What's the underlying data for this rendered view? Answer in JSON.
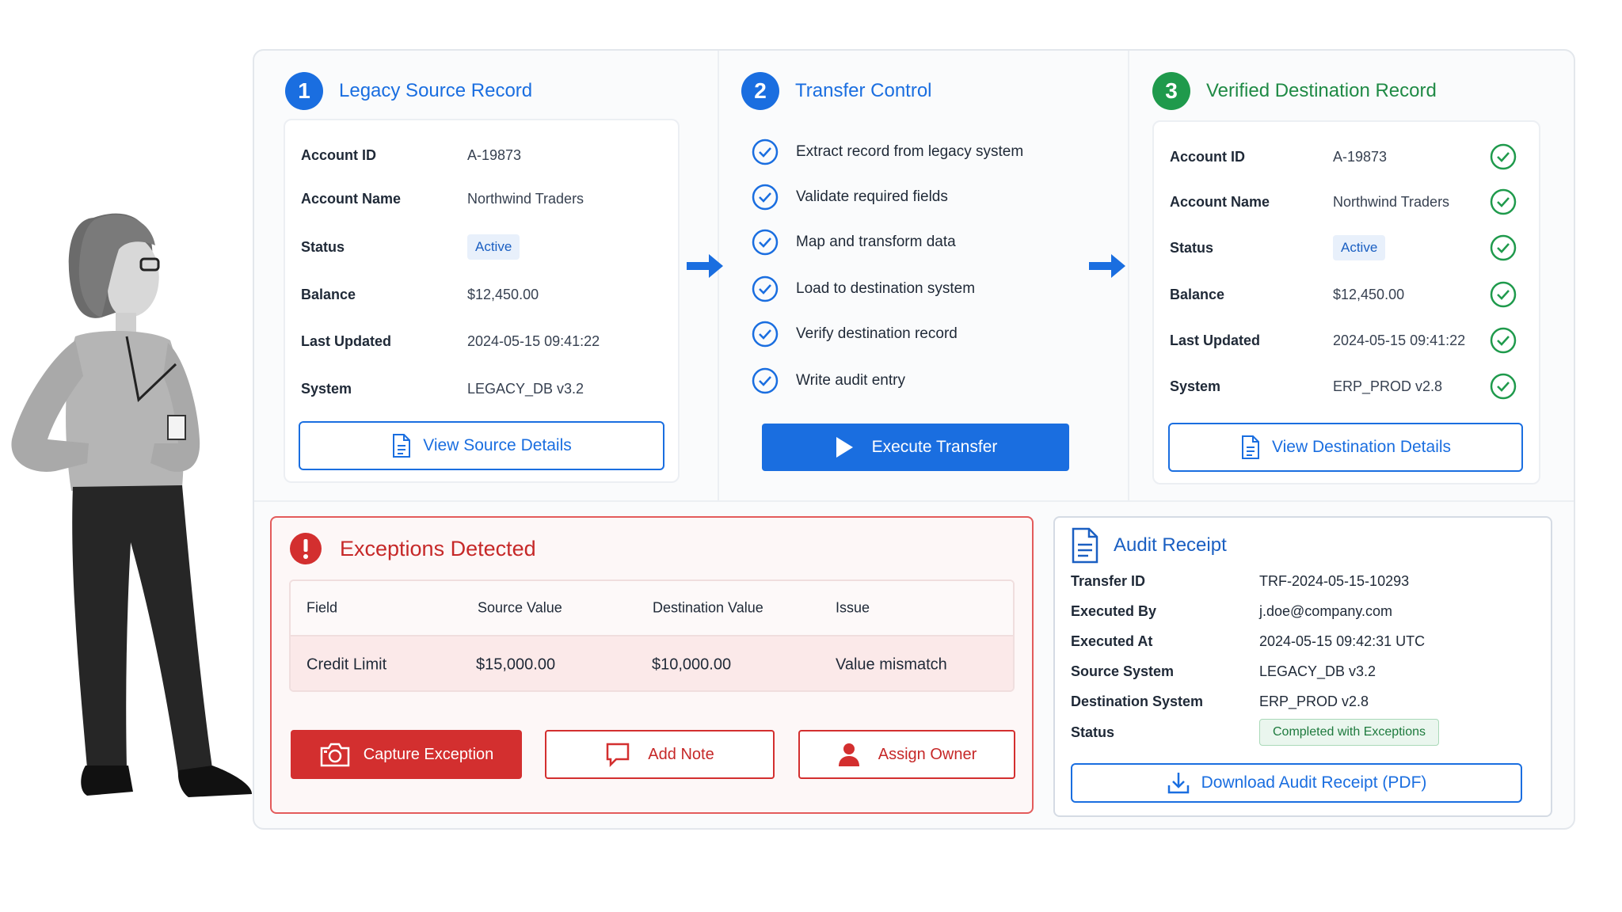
{
  "source": {
    "step": "1",
    "title": "Legacy Source Record",
    "fields": [
      {
        "label": "Account ID",
        "value": "A-19873"
      },
      {
        "label": "Account Name",
        "value": "Northwind Traders"
      },
      {
        "label": "Status",
        "value": "Active"
      },
      {
        "label": "Balance",
        "value": "$12,450.00"
      },
      {
        "label": "Last Updated",
        "value": "2024-05-15 09:41:22"
      },
      {
        "label": "System",
        "value": "LEGACY_DB v3.2"
      }
    ],
    "button": "View Source Details"
  },
  "control": {
    "step": "2",
    "title": "Transfer Control",
    "steps": [
      "Extract record from legacy system",
      "Validate required fields",
      "Map and transform data",
      "Load to destination system",
      "Verify destination record",
      "Write audit entry"
    ],
    "button": "Execute Transfer"
  },
  "destination": {
    "step": "3",
    "title": "Verified Destination Record",
    "fields": [
      {
        "label": "Account ID",
        "value": "A-19873"
      },
      {
        "label": "Account Name",
        "value": "Northwind Traders"
      },
      {
        "label": "Status",
        "value": "Active"
      },
      {
        "label": "Balance",
        "value": "$12,450.00"
      },
      {
        "label": "Last Updated",
        "value": "2024-05-15 09:41:22"
      },
      {
        "label": "System",
        "value": "ERP_PROD v2.8"
      }
    ],
    "button": "View Destination Details"
  },
  "exceptions": {
    "title": "Exceptions Detected",
    "columns": [
      "Field",
      "Source Value",
      "Destination Value",
      "Issue"
    ],
    "rows": [
      {
        "field": "Credit Limit",
        "source": "$15,000.00",
        "destination": "$10,000.00",
        "issue": "Value mismatch"
      }
    ],
    "buttons": {
      "capture": "Capture Exception",
      "note": "Add Note",
      "assign": "Assign Owner"
    }
  },
  "audit": {
    "title": "Audit Receipt",
    "fields": [
      {
        "label": "Transfer ID",
        "value": "TRF-2024-05-15-10293"
      },
      {
        "label": "Executed By",
        "value": "j.doe@company.com"
      },
      {
        "label": "Executed At",
        "value": "2024-05-15 09:42:31 UTC"
      },
      {
        "label": "Source System",
        "value": "LEGACY_DB v3.2"
      },
      {
        "label": "Destination System",
        "value": "ERP_PROD v2.8"
      }
    ],
    "status_label": "Status",
    "status_value": "Completed with Exceptions",
    "button": "Download Audit Receipt (PDF)"
  },
  "colors": {
    "primary": "#1a6ee0",
    "success": "#1f9a4c",
    "danger": "#d32f2f"
  }
}
